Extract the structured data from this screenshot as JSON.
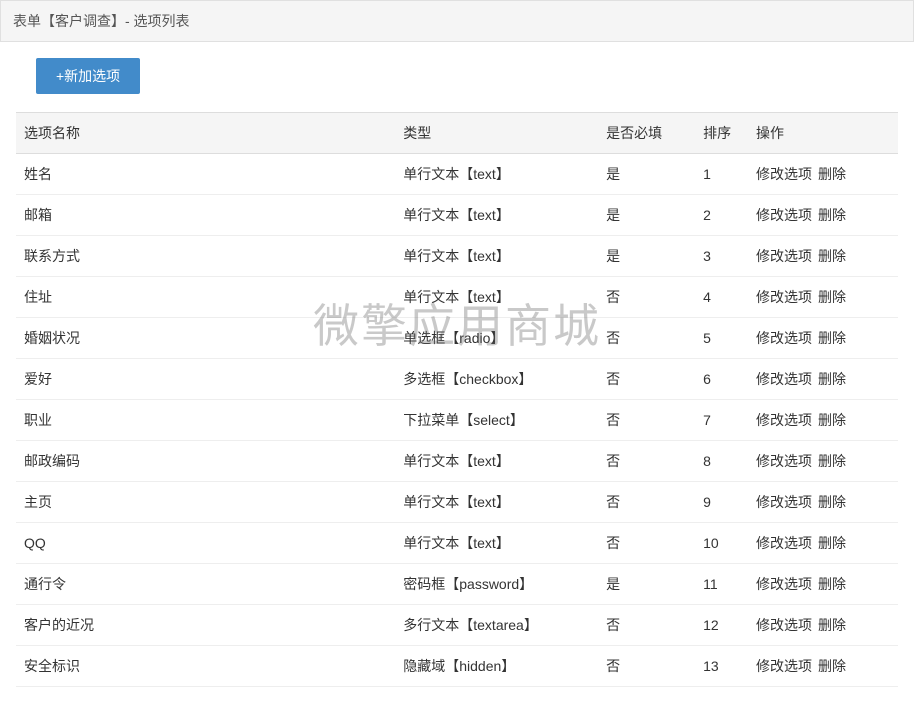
{
  "header": {
    "title": "表单【客户调查】- 选项列表"
  },
  "buttons": {
    "add": "+新加选项"
  },
  "table": {
    "headers": {
      "name": "选项名称",
      "type": "类型",
      "required": "是否必填",
      "sort": "排序",
      "actions": "操作"
    },
    "actions": {
      "edit": "修改选项",
      "delete": "删除"
    },
    "rows": [
      {
        "name": "姓名",
        "type": "单行文本【text】",
        "required": "是",
        "sort": "1"
      },
      {
        "name": "邮箱",
        "type": "单行文本【text】",
        "required": "是",
        "sort": "2"
      },
      {
        "name": "联系方式",
        "type": "单行文本【text】",
        "required": "是",
        "sort": "3"
      },
      {
        "name": "住址",
        "type": "单行文本【text】",
        "required": "否",
        "sort": "4"
      },
      {
        "name": "婚姻状况",
        "type": "单选框【radio】",
        "required": "否",
        "sort": "5"
      },
      {
        "name": "爱好",
        "type": "多选框【checkbox】",
        "required": "否",
        "sort": "6"
      },
      {
        "name": "职业",
        "type": "下拉菜单【select】",
        "required": "否",
        "sort": "7"
      },
      {
        "name": "邮政编码",
        "type": "单行文本【text】",
        "required": "否",
        "sort": "8"
      },
      {
        "name": "主页",
        "type": "单行文本【text】",
        "required": "否",
        "sort": "9"
      },
      {
        "name": "QQ",
        "type": "单行文本【text】",
        "required": "否",
        "sort": "10"
      },
      {
        "name": "通行令",
        "type": "密码框【password】",
        "required": "是",
        "sort": "11"
      },
      {
        "name": "客户的近况",
        "type": "多行文本【textarea】",
        "required": "否",
        "sort": "12"
      },
      {
        "name": "安全标识",
        "type": "隐藏域【hidden】",
        "required": "否",
        "sort": "13"
      }
    ]
  },
  "watermark": "微擎应用商城"
}
